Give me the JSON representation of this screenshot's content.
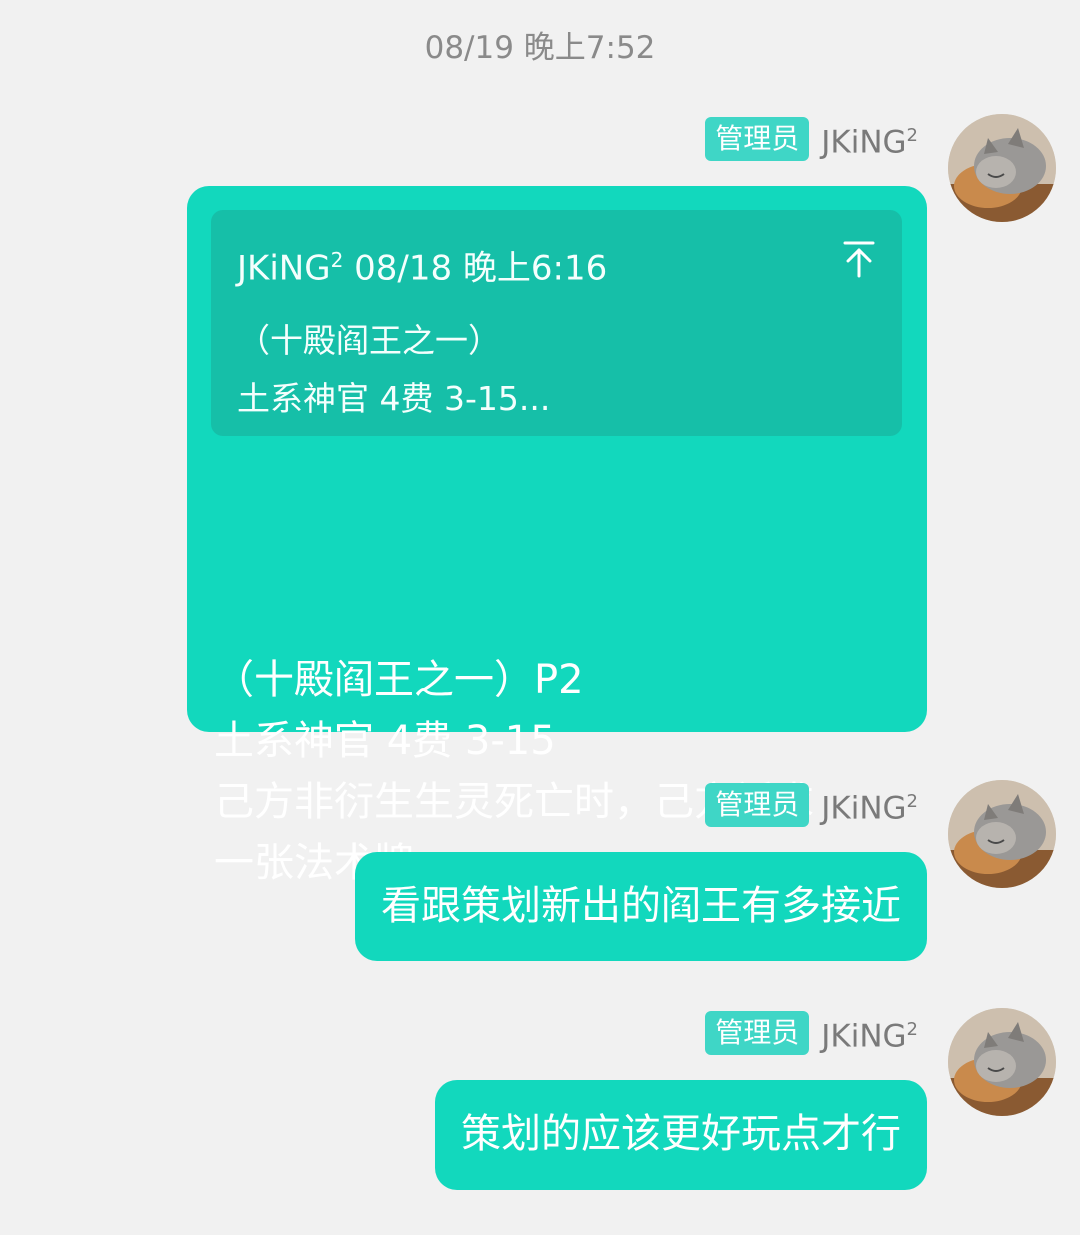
{
  "timestamp": "08/19 晚上7:52",
  "colors": {
    "background": "#f1f1f1",
    "bubble": "#12d8bd",
    "quote_block": "#16bfa8",
    "badge": "#3fd6c6"
  },
  "messages": [
    {
      "badge": "管理员",
      "sender_name": "JKiNG",
      "sender_sup": "2",
      "quote": {
        "sender_name": "JKiNG",
        "sender_sup": "2",
        "time": " 08/18 晚上6:16",
        "text": "（十殿阎王之一）\n土系神官 4费 3-15...",
        "icon": "jump-to-top-icon"
      },
      "text": "（十殿阎王之一）P2\n土系神官 4费 3-15\n己方非衍生生灵死亡时，己方祈求\n一张法术牌"
    },
    {
      "badge": "管理员",
      "sender_name": "JKiNG",
      "sender_sup": "2",
      "text": "看跟策划新出的阎王有多接近"
    },
    {
      "badge": "管理员",
      "sender_name": "JKiNG",
      "sender_sup": "2",
      "text": "策划的应该更好玩点才行"
    }
  ]
}
